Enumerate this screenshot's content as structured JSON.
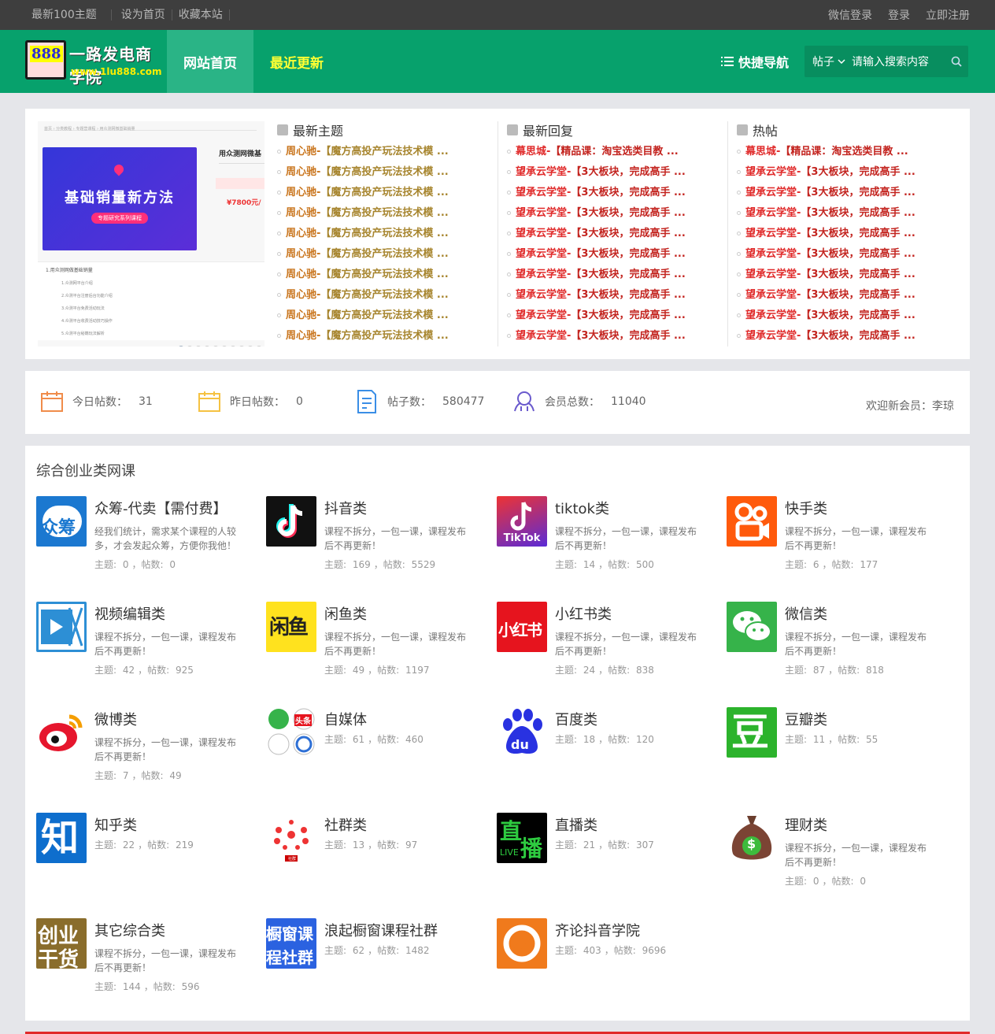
{
  "topbar": {
    "left": [
      "最新100主题",
      "设为首页",
      "收藏本站"
    ],
    "right": [
      "微信登录",
      "登录",
      "立即注册"
    ]
  },
  "header": {
    "logo_text": "一路发电商学院",
    "logo_num": "888",
    "logo_url": "www.1lu888.com",
    "nav_home": "网站首页",
    "nav_recent": "最近更新",
    "quick_nav": "快捷导航",
    "search_select": "帖子",
    "search_placeholder": "请输入搜索内容"
  },
  "banner": {
    "crumb": "首页 › 分类教程 › 专题营课程 › 用众测网微基础销量",
    "big_text": "基础销量新方法",
    "pill": "专题研究系列课程",
    "right_title": "用众测网微基",
    "price": "¥7800元/",
    "list": [
      "1.用众测网做基础销量",
      "1.众测网平台介绍",
      "2.众测平台注册后台功能介绍",
      "3.众测平台免费活动玩法",
      "4.众测平台收费活动技巧操作",
      "5.众测平台秘籍玩法解析"
    ]
  },
  "latest_topics": {
    "heading": "最新主题",
    "items": [
      {
        "author": "周心驰-",
        "title": "【魔方高投产玩法技术模 ..."
      },
      {
        "author": "周心驰-",
        "title": "【魔方高投产玩法技术模 ..."
      },
      {
        "author": "周心驰-",
        "title": "【魔方高投产玩法技术模 ..."
      },
      {
        "author": "周心驰-",
        "title": "【魔方高投产玩法技术模 ..."
      },
      {
        "author": "周心驰-",
        "title": "【魔方高投产玩法技术模 ..."
      },
      {
        "author": "周心驰-",
        "title": "【魔方高投产玩法技术模 ..."
      },
      {
        "author": "周心驰-",
        "title": "【魔方高投产玩法技术模 ..."
      },
      {
        "author": "周心驰-",
        "title": "【魔方高投产玩法技术模 ..."
      },
      {
        "author": "周心驰-",
        "title": "【魔方高投产玩法技术模 ..."
      },
      {
        "author": "周心驰-",
        "title": "【魔方高投产玩法技术模 ..."
      }
    ]
  },
  "latest_replies": {
    "heading": "最新回复",
    "items": [
      {
        "author": "幕思城-",
        "title": "【精品课：淘宝选类目教 ..."
      },
      {
        "author": "望承云学堂-",
        "title": "【3大板块，完成高手 ..."
      },
      {
        "author": "望承云学堂-",
        "title": "【3大板块，完成高手 ..."
      },
      {
        "author": "望承云学堂-",
        "title": "【3大板块，完成高手 ..."
      },
      {
        "author": "望承云学堂-",
        "title": "【3大板块，完成高手 ..."
      },
      {
        "author": "望承云学堂-",
        "title": "【3大板块，完成高手 ..."
      },
      {
        "author": "望承云学堂-",
        "title": "【3大板块，完成高手 ..."
      },
      {
        "author": "望承云学堂-",
        "title": "【3大板块，完成高手 ..."
      },
      {
        "author": "望承云学堂-",
        "title": "【3大板块，完成高手 ..."
      },
      {
        "author": "望承云学堂-",
        "title": "【3大板块，完成高手 ..."
      }
    ]
  },
  "hot_posts": {
    "heading": "热帖",
    "items": [
      {
        "author": "幕思城-",
        "title": "【精品课：淘宝选类目教 ..."
      },
      {
        "author": "望承云学堂-",
        "title": "【3大板块，完成高手 ..."
      },
      {
        "author": "望承云学堂-",
        "title": "【3大板块，完成高手 ..."
      },
      {
        "author": "望承云学堂-",
        "title": "【3大板块，完成高手 ..."
      },
      {
        "author": "望承云学堂-",
        "title": "【3大板块，完成高手 ..."
      },
      {
        "author": "望承云学堂-",
        "title": "【3大板块，完成高手 ..."
      },
      {
        "author": "望承云学堂-",
        "title": "【3大板块，完成高手 ..."
      },
      {
        "author": "望承云学堂-",
        "title": "【3大板块，完成高手 ..."
      },
      {
        "author": "望承云学堂-",
        "title": "【3大板块，完成高手 ..."
      },
      {
        "author": "望承云学堂-",
        "title": "【3大板块，完成高手 ..."
      }
    ]
  },
  "stats": {
    "today_label": "今日帖数：",
    "today_value": "31",
    "yesterday_label": "昨日帖数：",
    "yesterday_value": "0",
    "posts_label": "帖子数：",
    "posts_value": "580477",
    "members_label": "会员总数：",
    "members_value": "11040",
    "welcome_label": "欢迎新会员：",
    "welcome_name": "李琼"
  },
  "forum": {
    "heading": "综合创业类网课",
    "topic_label": "主题: ",
    "post_label": "，帖数: ",
    "items": [
      {
        "name": "众筹-代卖【需付费】",
        "desc": "经我们统计，需求某个课程的人较多，才会发起众筹，方便你我他！",
        "topics": "0",
        "posts": "0",
        "icon": "crowdfund-icon"
      },
      {
        "name": "抖音类",
        "desc": "课程不拆分，一包一课，课程发布后不再更新！",
        "topics": "169",
        "posts": "5529",
        "icon": "douyin-icon"
      },
      {
        "name": "tiktok类",
        "desc": "课程不拆分，一包一课，课程发布后不再更新！",
        "topics": "14",
        "posts": "500",
        "icon": "tiktok-icon"
      },
      {
        "name": "快手类",
        "desc": "课程不拆分，一包一课，课程发布后不再更新！",
        "topics": "6",
        "posts": "177",
        "icon": "kuaishou-icon"
      },
      {
        "name": "视频编辑类",
        "desc": "课程不拆分，一包一课，课程发布后不再更新！",
        "topics": "42",
        "posts": "925",
        "icon": "video-edit-icon"
      },
      {
        "name": "闲鱼类",
        "desc": "课程不拆分，一包一课，课程发布后不再更新！",
        "topics": "49",
        "posts": "1197",
        "icon": "xianyu-icon"
      },
      {
        "name": "小红书类",
        "desc": "课程不拆分，一包一课，课程发布后不再更新！",
        "topics": "24",
        "posts": "838",
        "icon": "xiaohongshu-icon"
      },
      {
        "name": "微信类",
        "desc": "课程不拆分，一包一课，课程发布后不再更新！",
        "topics": "87",
        "posts": "818",
        "icon": "wechat-icon"
      },
      {
        "name": "微博类",
        "desc": "课程不拆分，一包一课，课程发布后不再更新！",
        "topics": "7",
        "posts": "49",
        "icon": "weibo-icon"
      },
      {
        "name": "自媒体",
        "desc": "",
        "topics": "61",
        "posts": "460",
        "icon": "self-media-icon"
      },
      {
        "name": "百度类",
        "desc": "",
        "topics": "18",
        "posts": "120",
        "icon": "baidu-icon"
      },
      {
        "name": "豆瓣类",
        "desc": "",
        "topics": "11",
        "posts": "55",
        "icon": "douban-icon"
      },
      {
        "name": "知乎类",
        "desc": "",
        "topics": "22",
        "posts": "219",
        "icon": "zhihu-icon"
      },
      {
        "name": "社群类",
        "desc": "",
        "topics": "13",
        "posts": "97",
        "icon": "community-icon"
      },
      {
        "name": "直播类",
        "desc": "",
        "topics": "21",
        "posts": "307",
        "icon": "live-icon"
      },
      {
        "name": "理财类",
        "desc": "课程不拆分，一包一课，课程发布后不再更新！",
        "topics": "0",
        "posts": "0",
        "icon": "money-bag-icon"
      },
      {
        "name": "其它综合类",
        "desc": "课程不拆分，一包一课，课程发布后不再更新！",
        "topics": "144",
        "posts": "596",
        "icon": "startup-icon"
      },
      {
        "name": "浪起橱窗课程社群",
        "desc": "",
        "topics": "62",
        "posts": "1482",
        "icon": "showcase-icon"
      },
      {
        "name": "齐论抖音学院",
        "desc": "",
        "topics": "403",
        "posts": "9696",
        "icon": "qilun-icon"
      }
    ],
    "icon_texts": {
      "crowdfund": "众筹",
      "tiktok": "TikTok",
      "xianyu": "闲鱼",
      "xiaohongshu": "小红书",
      "zhihu": "知",
      "douban": "豆",
      "toutiao": "头条",
      "live_1": "直",
      "live_2": "播",
      "live_3": "LIVE",
      "startup_1": "创业",
      "startup_2": "干货",
      "showcase_1": "橱窗课",
      "showcase_2": "程社群",
      "community": "社群",
      "baidu": "du"
    }
  },
  "colors": {
    "brand_green": "#07a16c",
    "accent_red": "#e02a2a",
    "topbar": "#3e3e3e"
  }
}
